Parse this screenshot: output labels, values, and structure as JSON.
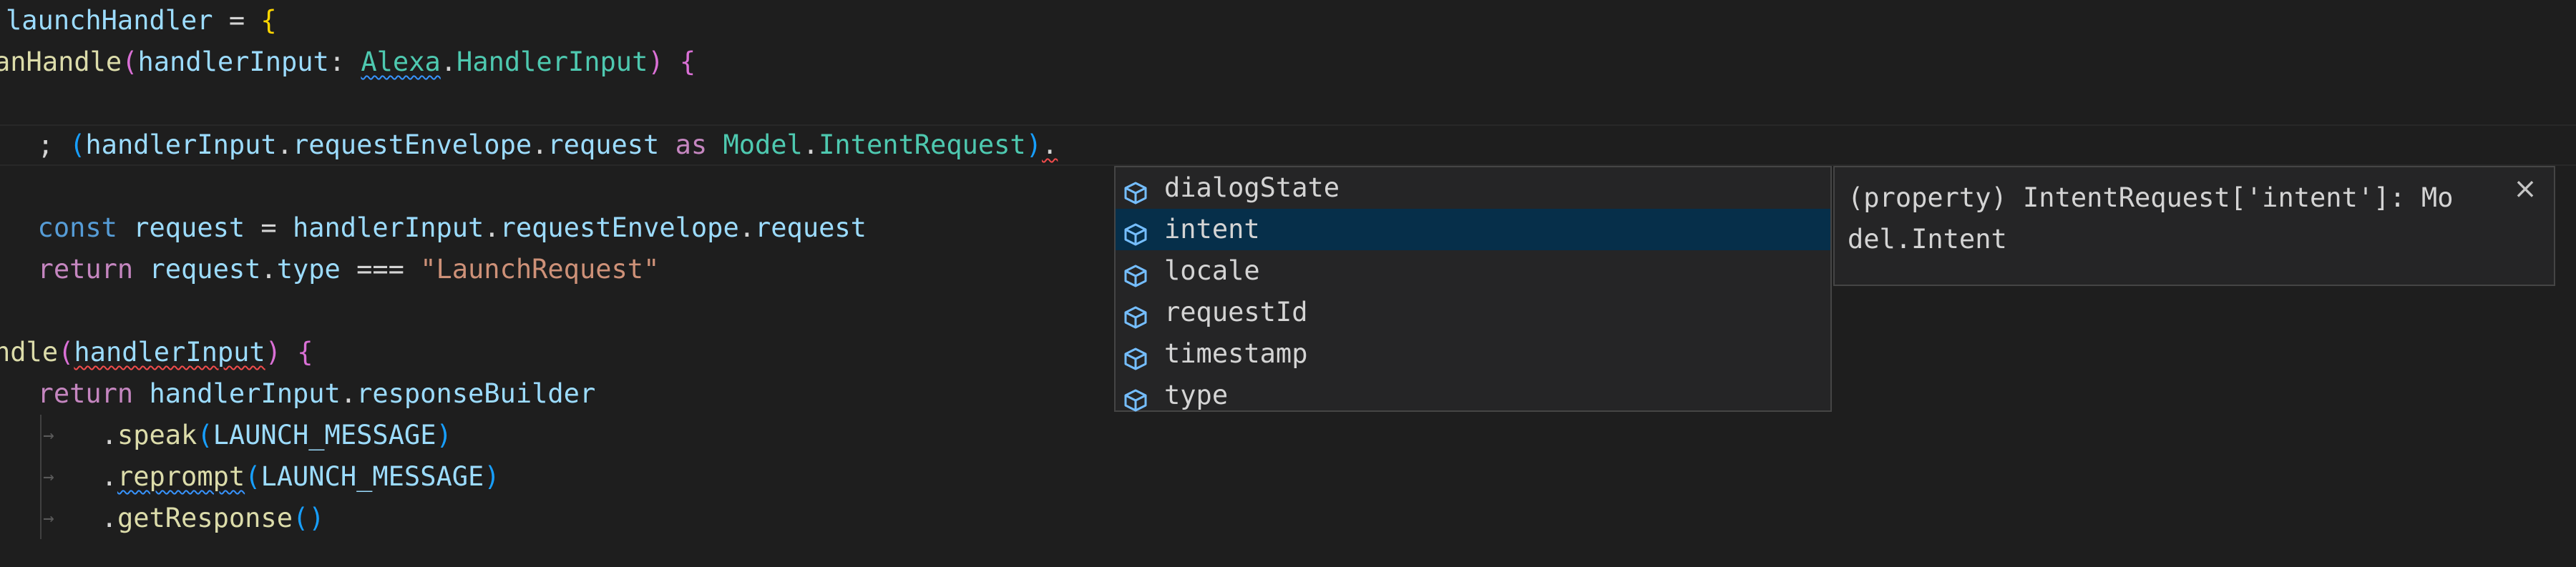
{
  "editor": {
    "lines": [
      [
        {
          "t": "launchHandler",
          "c": "c-var"
        },
        {
          "t": " = ",
          "c": "c-punc"
        },
        {
          "t": "{",
          "c": "c-br1"
        }
      ],
      [
        {
          "t": "anHandle",
          "c": "c-fn"
        },
        {
          "t": "(",
          "c": "c-br2"
        },
        {
          "t": "handlerInput",
          "c": "c-var"
        },
        {
          "t": ": ",
          "c": "c-punc"
        },
        {
          "t": "Alexa",
          "c": "c-type squig-info"
        },
        {
          "t": ".",
          "c": "c-punc"
        },
        {
          "t": "HandlerInput",
          "c": "c-type"
        },
        {
          "t": ")",
          "c": "c-br2"
        },
        {
          "t": " ",
          "c": "c-punc"
        },
        {
          "t": "{",
          "c": "c-br2"
        }
      ],
      [],
      [
        {
          "t": "  ; ",
          "c": "c-punc"
        },
        {
          "t": "(",
          "c": "c-br3"
        },
        {
          "t": "handlerInput",
          "c": "c-var"
        },
        {
          "t": ".",
          "c": "c-punc"
        },
        {
          "t": "requestEnvelope",
          "c": "c-var"
        },
        {
          "t": ".",
          "c": "c-punc"
        },
        {
          "t": "request",
          "c": "c-var"
        },
        {
          "t": " as ",
          "c": "c-ctl"
        },
        {
          "t": "Model",
          "c": "c-type"
        },
        {
          "t": ".",
          "c": "c-punc"
        },
        {
          "t": "IntentRequest",
          "c": "c-type"
        },
        {
          "t": ")",
          "c": "c-br3"
        },
        {
          "t": ".",
          "c": "c-punc squig"
        }
      ],
      [],
      [
        {
          "t": "  const ",
          "c": "c-kw"
        },
        {
          "t": "request",
          "c": "c-var"
        },
        {
          "t": " = ",
          "c": "c-punc"
        },
        {
          "t": "handlerInput",
          "c": "c-var"
        },
        {
          "t": ".",
          "c": "c-punc"
        },
        {
          "t": "requestEnvelope",
          "c": "c-var"
        },
        {
          "t": ".",
          "c": "c-punc"
        },
        {
          "t": "request",
          "c": "c-var"
        }
      ],
      [
        {
          "t": "  return ",
          "c": "c-ctl"
        },
        {
          "t": "request",
          "c": "c-var"
        },
        {
          "t": ".",
          "c": "c-punc"
        },
        {
          "t": "type",
          "c": "c-var"
        },
        {
          "t": " === ",
          "c": "c-punc"
        },
        {
          "t": "\"LaunchRequest\"",
          "c": "c-str"
        }
      ],
      [],
      [
        {
          "t": "ndle",
          "c": "c-fn"
        },
        {
          "t": "(",
          "c": "c-br2"
        },
        {
          "t": "handlerInput",
          "c": "c-var squig"
        },
        {
          "t": ")",
          "c": "c-br2"
        },
        {
          "t": " ",
          "c": "c-punc"
        },
        {
          "t": "{",
          "c": "c-br2"
        }
      ],
      [
        {
          "t": "  return ",
          "c": "c-ctl"
        },
        {
          "t": "handlerInput",
          "c": "c-var"
        },
        {
          "t": ".",
          "c": "c-punc"
        },
        {
          "t": "responseBuilder",
          "c": "c-var"
        }
      ],
      [
        {
          "t": "      .",
          "c": "c-punc"
        },
        {
          "t": "speak",
          "c": "c-fn"
        },
        {
          "t": "(",
          "c": "c-br3"
        },
        {
          "t": "LAUNCH_MESSAGE",
          "c": "c-var"
        },
        {
          "t": ")",
          "c": "c-br3"
        }
      ],
      [
        {
          "t": "      .",
          "c": "c-punc"
        },
        {
          "t": "reprompt",
          "c": "c-fn squig-info"
        },
        {
          "t": "(",
          "c": "c-br3"
        },
        {
          "t": "LAUNCH_MESSAGE",
          "c": "c-var"
        },
        {
          "t": ")",
          "c": "c-br3"
        }
      ],
      [
        {
          "t": "      .",
          "c": "c-punc"
        },
        {
          "t": "getResponse",
          "c": "c-fn"
        },
        {
          "t": "(",
          "c": "c-br3"
        },
        {
          "t": ")",
          "c": "c-br3"
        }
      ]
    ]
  },
  "suggest": {
    "icon": "symbol-property-icon",
    "selected_index": 1,
    "items": [
      "dialogState",
      "intent",
      "locale",
      "requestId",
      "timestamp",
      "type"
    ]
  },
  "details": {
    "text": "(property) IntentRequest['intent']: Mo\ndel.Intent",
    "close_label": "×"
  },
  "colors": {
    "background": "#1e1e1e",
    "widget_background": "#252526",
    "selected_item": "#062f4a",
    "icon_blue": "#75beff"
  }
}
